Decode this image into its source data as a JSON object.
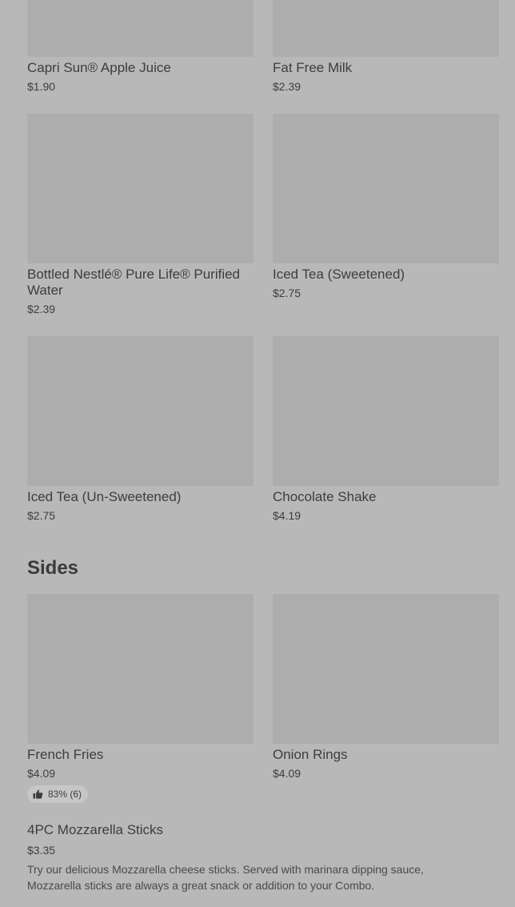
{
  "drinks": [
    {
      "name": "Capri Sun® Apple Juice",
      "price": "$1.90"
    },
    {
      "name": "Fat Free Milk",
      "price": "$2.39"
    },
    {
      "name": "Bottled Nestlé® Pure Life® Purified Water",
      "price": "$2.39"
    },
    {
      "name": "Iced Tea (Sweetened)",
      "price": "$2.75"
    },
    {
      "name": "Iced Tea (Un-Sweetened)",
      "price": "$2.75"
    },
    {
      "name": "Chocolate Shake",
      "price": "$4.19"
    }
  ],
  "sides": {
    "title": "Sides",
    "items": [
      {
        "name": "French Fries",
        "price": "$4.09",
        "rating": "83% (6)",
        "rating_icon": "thumbs-up-icon"
      },
      {
        "name": "Onion Rings",
        "price": "$4.09"
      }
    ],
    "wide_item": {
      "name": "4PC Mozzarella Sticks",
      "price": "$3.35",
      "description": "Try our delicious Mozzarella cheese sticks. Served with marinara dipping sauce, Mozzarella sticks are always a great snack or addition to your Combo."
    }
  },
  "colors": {
    "background": "#b8b8b8",
    "image_placeholder": "#adadad",
    "text": "#3d3d3d"
  }
}
